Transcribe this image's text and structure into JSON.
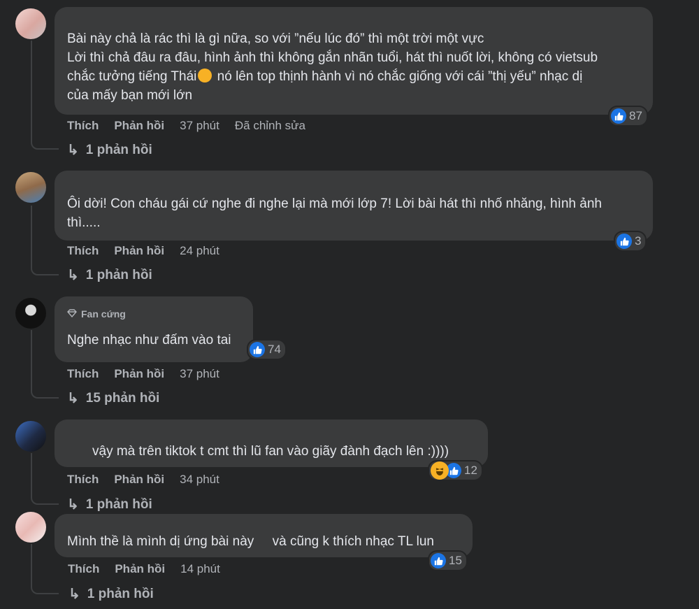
{
  "comments": [
    {
      "text": "Bài này chả là rác thì là gì nữa, so với ”nếu lúc đó” thì một trời một vực\nLời thì chả đâu ra đâu, hình ảnh thì không gắn nhãn tuổi, hát thì nuốt lời, không có vietsub\nchắc tưởng tiếng Thái",
      "text_tail": " nó lên top thịnh hành vì nó chắc giống với cái ”thị yếu” nhạc dị\ncủa mấy bạn mới lớn",
      "like_label": "Thích",
      "reply_label": "Phản hồi",
      "time": "37 phút",
      "edited": "Đã chỉnh sửa",
      "reactions": "87",
      "replies": "1 phản hồi"
    },
    {
      "text": "Ôi dời! Con cháu gái cứ nghe đi nghe lại mà mới lớp 7! Lời bài hát thì nhố nhăng, hình ảnh\nthì.....",
      "like_label": "Thích",
      "reply_label": "Phản hồi",
      "time": "24 phút",
      "reactions": "3",
      "replies": "1 phản hồi"
    },
    {
      "badge": "Fan cứng",
      "text": "Nghe nhạc như đấm vào tai",
      "like_label": "Thích",
      "reply_label": "Phản hồi",
      "time": "37 phút",
      "reactions": "74",
      "replies": "15 phản hồi"
    },
    {
      "text": "vậy mà trên tiktok t cmt thì lũ fan vào giãy đành đạch lên :))))",
      "like_label": "Thích",
      "reply_label": "Phản hồi",
      "time": "34 phút",
      "reactions": "12",
      "replies": "1 phản hồi"
    },
    {
      "text": "Mình thề là mình dị ứng bài này     và cũng k thích nhạc TL lun",
      "like_label": "Thích",
      "reply_label": "Phản hồi",
      "time": "14 phút",
      "reactions": "15",
      "replies": "1 phản hồi"
    }
  ],
  "colors": {
    "background": "#242526",
    "bubble": "#3a3b3c",
    "like_blue": "#1b74e4",
    "haha_yellow": "#f7b125"
  },
  "icons": {
    "like": "thumbs-up-icon",
    "haha": "haha-icon",
    "reply": "reply-arrow-icon",
    "badge": "diamond-icon"
  }
}
